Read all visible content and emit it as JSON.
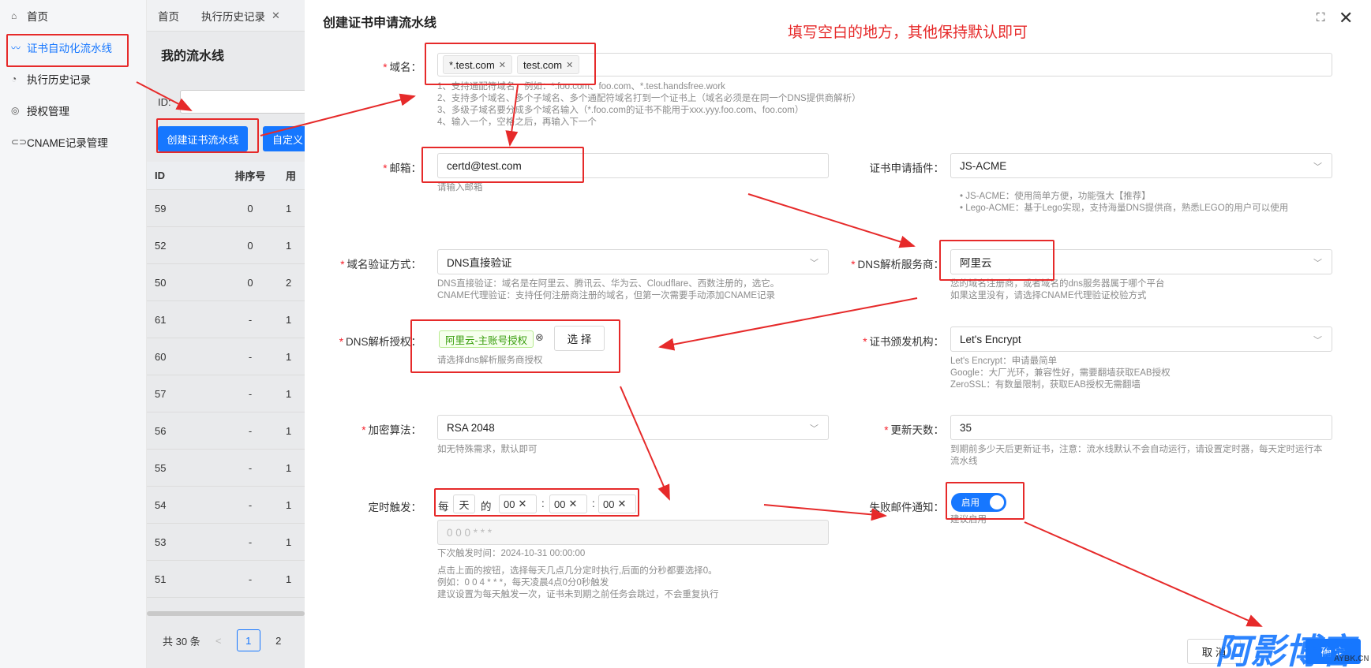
{
  "sidebar": {
    "items": [
      {
        "icon": "home-icon",
        "label": "首页"
      },
      {
        "icon": "trend-icon",
        "label": "证书自动化流水线"
      },
      {
        "icon": "history-icon",
        "label": "执行历史记录"
      },
      {
        "icon": "auth-icon",
        "label": "授权管理"
      },
      {
        "icon": "link-icon",
        "label": "CNAME记录管理"
      }
    ]
  },
  "bg": {
    "tabs": [
      "首页",
      "执行历史记录"
    ],
    "tab_close": "✕",
    "title": "我的流水线",
    "id_label": "ID:",
    "create_button": "创建证书流水线",
    "custom_button": "自定义",
    "columns": [
      "ID",
      "排序号",
      "用"
    ],
    "rows": [
      [
        "59",
        "0",
        "1"
      ],
      [
        "52",
        "0",
        "1"
      ],
      [
        "50",
        "0",
        "2"
      ],
      [
        "61",
        "-",
        "1"
      ],
      [
        "60",
        "-",
        "1"
      ],
      [
        "57",
        "-",
        "1"
      ],
      [
        "56",
        "-",
        "1"
      ],
      [
        "55",
        "-",
        "1"
      ],
      [
        "54",
        "-",
        "1"
      ],
      [
        "53",
        "-",
        "1"
      ],
      [
        "51",
        "-",
        "1"
      ]
    ],
    "total": "共 30 条",
    "pages": [
      "1",
      "2"
    ],
    "prev": "<"
  },
  "modal": {
    "title": "创建证书申请流水线",
    "annotation": "填写空白的地方，其他保持默认即可",
    "domain": {
      "label": "域名",
      "tags": [
        "*.test.com",
        "test.com"
      ],
      "help": [
        "1、支持通配符域名，例如：*.foo.com、foo.com、*.test.handsfree.work",
        "2、支持多个域名、多个子域名、多个通配符域名打到一个证书上（域名必须是在同一个DNS提供商解析）",
        "3、多级子域名要分成多个域名输入（*.foo.com的证书不能用于xxx.yyy.foo.com、foo.com）",
        "4、输入一个，空格之后，再输入下一个"
      ]
    },
    "email": {
      "label": "邮箱",
      "value": "certd@test.com",
      "help": "请输入邮箱"
    },
    "plugin": {
      "label": "证书申请插件",
      "value": "JS-ACME",
      "help": [
        "JS-ACME：使用简单方便，功能强大【推荐】",
        "Lego-ACME：基于Lego实现，支持海量DNS提供商，熟悉LEGO的用户可以使用"
      ]
    },
    "verify": {
      "label": "域名验证方式",
      "value": "DNS直接验证",
      "help": [
        "DNS直接验证：域名是在阿里云、腾讯云、华为云、Cloudflare、西数注册的，选它。",
        "CNAME代理验证：支持任何注册商注册的域名，但第一次需要手动添加CNAME记录"
      ]
    },
    "dns_provider": {
      "label": "DNS解析服务商",
      "value": "阿里云",
      "help": [
        "您的域名注册商，或者域名的dns服务器属于哪个平台",
        "如果这里没有，请选择CNAME代理验证校验方式"
      ]
    },
    "dns_auth": {
      "label": "DNS解析授权",
      "tag": "阿里云-主账号授权",
      "select_button": "选 择",
      "help": "请选择dns解析服务商授权"
    },
    "ca": {
      "label": "证书颁发机构",
      "value": "Let's Encrypt",
      "help": [
        "Let's Encrypt：申请最简单",
        "Google：大厂光环，兼容性好，需要翻墙获取EAB授权",
        "ZeroSSL：有数量限制，获取EAB授权无需翻墙"
      ]
    },
    "algo": {
      "label": "加密算法",
      "value": "RSA 2048",
      "help": "如无特殊需求，默认即可"
    },
    "renew": {
      "label": "更新天数",
      "value": "35",
      "help": [
        "到期前多少天后更新证书，注意：流水线默认不会自动运行，请设置定时器，每天定时运行本",
        "流水线"
      ]
    },
    "cron": {
      "label": "定时触发",
      "every": "每",
      "unit": "天",
      "of": "的",
      "hh": "00",
      "mm": "00",
      "ss": "00",
      "sep": ":",
      "clear": "✕",
      "expr": "0 0 0 * * *",
      "next": "下次触发时间：2024-10-31 00:00:00",
      "help": [
        "点击上面的按钮，选择每天几点几分定时执行,后面的分秒都要选择0。",
        "例如：0 0 4 * * *，每天凌晨4点0分0秒触发",
        "建议设置为每天触发一次，证书未到期之前任务会跳过，不会重复执行"
      ]
    },
    "notify": {
      "label": "失败邮件通知",
      "switch_text": "启用",
      "help": "建议启用"
    },
    "cancel_button": "取 消",
    "confirm_button": "确 定",
    "watermark": "阿影博客",
    "watermark_sub": "AYBK.CN"
  },
  "colors": {
    "accent": "#1677ff",
    "annotation": "#e62a2a"
  }
}
